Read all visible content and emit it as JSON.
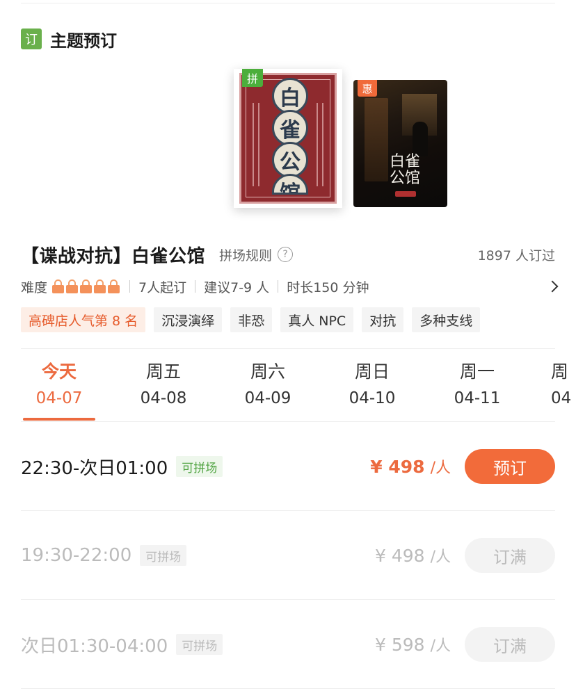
{
  "section": {
    "badge": "订",
    "title": "主题预订"
  },
  "posters": [
    {
      "tag": "拼",
      "title_chars": [
        "白",
        "雀",
        "公",
        "馆"
      ]
    },
    {
      "tag": "惠",
      "title": "白雀公馆"
    }
  ],
  "game": {
    "title": "【谍战对抗】白雀公馆",
    "rules_label": "拼场规则",
    "help_icon": "?",
    "booked": "1897 人订过"
  },
  "info": {
    "difficulty_label": "难度",
    "difficulty_level": 5,
    "min_players": "7人起订",
    "suggest": "建议7-9 人",
    "duration": "时长150 分钟"
  },
  "tags": [
    "高碑店人气第 8 名",
    "沉浸演绎",
    "非恐",
    "真人 NPC",
    "对抗",
    "多种支线"
  ],
  "dates": [
    {
      "dow": "今天",
      "date": "04-07"
    },
    {
      "dow": "周五",
      "date": "04-08"
    },
    {
      "dow": "周六",
      "date": "04-09"
    },
    {
      "dow": "周日",
      "date": "04-10"
    },
    {
      "dow": "周一",
      "date": "04-11"
    },
    {
      "dow": "周",
      "date": "04"
    }
  ],
  "slots": [
    {
      "time": "22:30-次日01:00",
      "badge": "可拼场",
      "price": "¥ 498",
      "unit": "/人",
      "action": "预订",
      "available": true
    },
    {
      "time": "19:30-22:00",
      "badge": "可拼场",
      "price": "¥ 498",
      "unit": "/人",
      "action": "订满",
      "available": false
    },
    {
      "time": "次日01:30-04:00",
      "badge": "可拼场",
      "price": "¥ 598",
      "unit": "/人",
      "action": "订满",
      "available": false
    }
  ],
  "colors": {
    "accent": "#ec6a3f",
    "green": "#6ab04c"
  }
}
